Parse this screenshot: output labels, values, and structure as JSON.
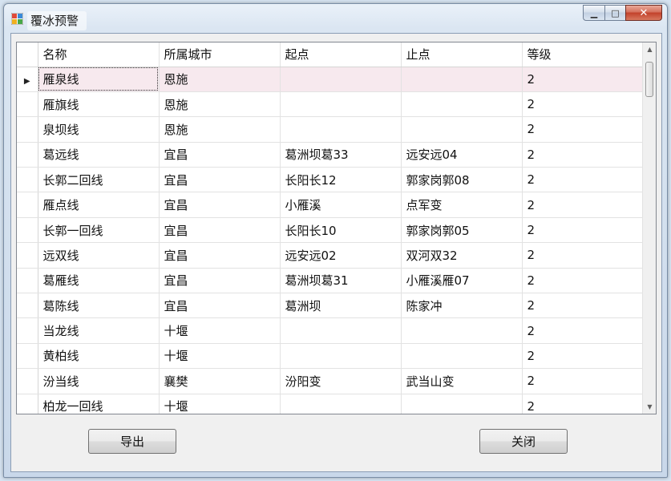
{
  "window": {
    "title": "覆冰预警",
    "controls": {
      "minimize": "▁",
      "maximize": "□",
      "close": "✕"
    }
  },
  "grid": {
    "columns": [
      "名称",
      "所属城市",
      "起点",
      "止点",
      "等级"
    ],
    "selected_row": 0,
    "rows": [
      [
        "雁泉线",
        "恩施",
        "",
        "",
        "2"
      ],
      [
        "雁旗线",
        "恩施",
        "",
        "",
        "2"
      ],
      [
        "泉坝线",
        "恩施",
        "",
        "",
        "2"
      ],
      [
        "葛远线",
        "宜昌",
        "葛洲坝葛33",
        "远安远04",
        "2"
      ],
      [
        "长郭二回线",
        "宜昌",
        "长阳长12",
        "郭家岗郭08",
        "2"
      ],
      [
        "雁点线",
        "宜昌",
        "小雁溪",
        "点军变",
        "2"
      ],
      [
        "长郭一回线",
        "宜昌",
        "长阳长10",
        "郭家岗郭05",
        "2"
      ],
      [
        "远双线",
        "宜昌",
        "远安远02",
        "双河双32",
        "2"
      ],
      [
        "葛雁线",
        "宜昌",
        "葛洲坝葛31",
        "小雁溪雁07",
        "2"
      ],
      [
        "葛陈线",
        "宜昌",
        "葛洲坝",
        "陈家冲",
        "2"
      ],
      [
        "当龙线",
        "十堰",
        "",
        "",
        "2"
      ],
      [
        "黄柏线",
        "十堰",
        "",
        "",
        "2"
      ],
      [
        "汾当线",
        "襄樊",
        "汾阳变",
        "武当山变",
        "2"
      ],
      [
        "柏龙一回线",
        "十堰",
        "",
        "",
        "2"
      ]
    ]
  },
  "buttons": {
    "export": "导出",
    "close": "关闭"
  },
  "colors": {
    "selected_row": "#f7e9ee",
    "close_button": "#c2412a"
  }
}
